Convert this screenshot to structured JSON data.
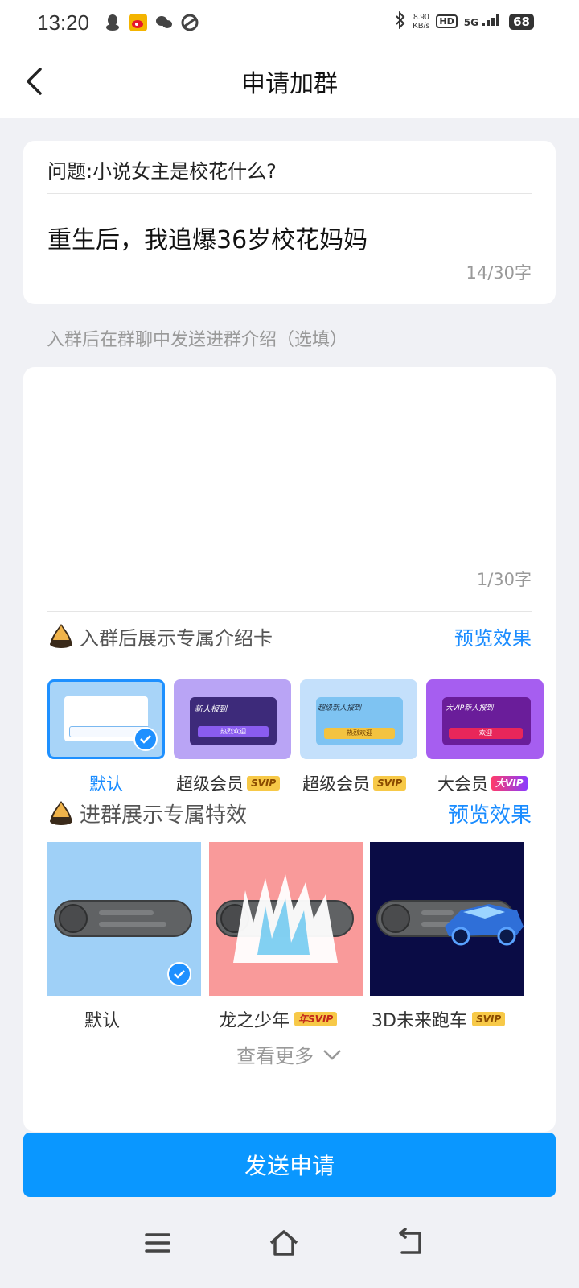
{
  "status_bar": {
    "time": "13:20",
    "icons": [
      "qq-icon",
      "weibo-icon",
      "wechat-icon",
      "game-icon"
    ],
    "bluetooth": "bluetooth-icon",
    "speed_value": "8.90",
    "speed_unit": "KB/s",
    "hd": "HD",
    "network": "5G",
    "battery": "68"
  },
  "header": {
    "title": "申请加群"
  },
  "question": {
    "label": "问题:小说女主是校花什么?",
    "answer": "重生后，我追爆36岁校花妈妈",
    "count": "14/30字"
  },
  "intro_hint": "入群后在群聊中发送进群介绍（选填）",
  "intro": {
    "value": "",
    "count": "1/30字"
  },
  "intro_card_section": {
    "title": "入群后展示专属介绍卡",
    "preview": "预览效果",
    "cards": [
      {
        "label": "默认",
        "badge": "",
        "selected": true
      },
      {
        "label": "超级会员",
        "badge": "SVIP",
        "selected": false,
        "banner": "新人报到",
        "button": "热烈欢迎"
      },
      {
        "label": "超级会员",
        "badge": "SVIP",
        "selected": false,
        "banner": "超级新人报到",
        "button": "热烈欢迎"
      },
      {
        "label": "大会员",
        "badge": "大VIP",
        "selected": false,
        "banner": "大VIP新人报到",
        "button": "欢迎"
      }
    ]
  },
  "effects_section": {
    "title": "进群展示专属特效",
    "preview": "预览效果",
    "items": [
      {
        "label": "默认",
        "badge": "",
        "selected": true,
        "color": "#9fd0f7"
      },
      {
        "label": "龙之少年",
        "badge": "年SVIP",
        "selected": false,
        "color": "#f99a9a"
      },
      {
        "label": "3D未来跑车",
        "badge": "SVIP",
        "selected": false,
        "color": "#0a0c45"
      }
    ]
  },
  "see_more": "查看更多",
  "send_button": "发送申请",
  "colors": {
    "accent": "#1a8cff",
    "button": "#0a97ff",
    "svip": "#f7c948"
  }
}
